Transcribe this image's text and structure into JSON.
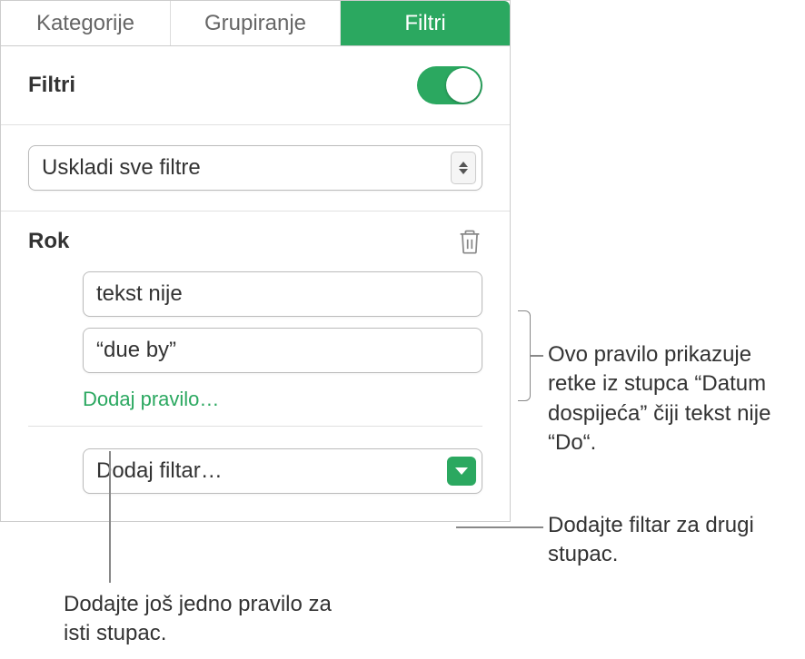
{
  "tabs": {
    "categories": "Kategorije",
    "grouping": "Grupiranje",
    "filters": "Filtri"
  },
  "header": {
    "title": "Filtri"
  },
  "match": {
    "label": "Uskladi sve filtre"
  },
  "column": {
    "name": "Rok"
  },
  "rule": {
    "condition": "tekst nije",
    "value": "“due by”",
    "add_link": "Dodaj pravilo…"
  },
  "add_filter": {
    "label": "Dodaj filtar…"
  },
  "callouts": {
    "rule_desc": "Ovo pravilo prikazuje retke iz stupca “Datum dospijeća” čiji tekst nije “Do“.",
    "add_filter_desc": "Dodajte filtar za drugi stupac.",
    "add_rule_desc": "Dodajte još jedno pravilo za isti stupac."
  }
}
